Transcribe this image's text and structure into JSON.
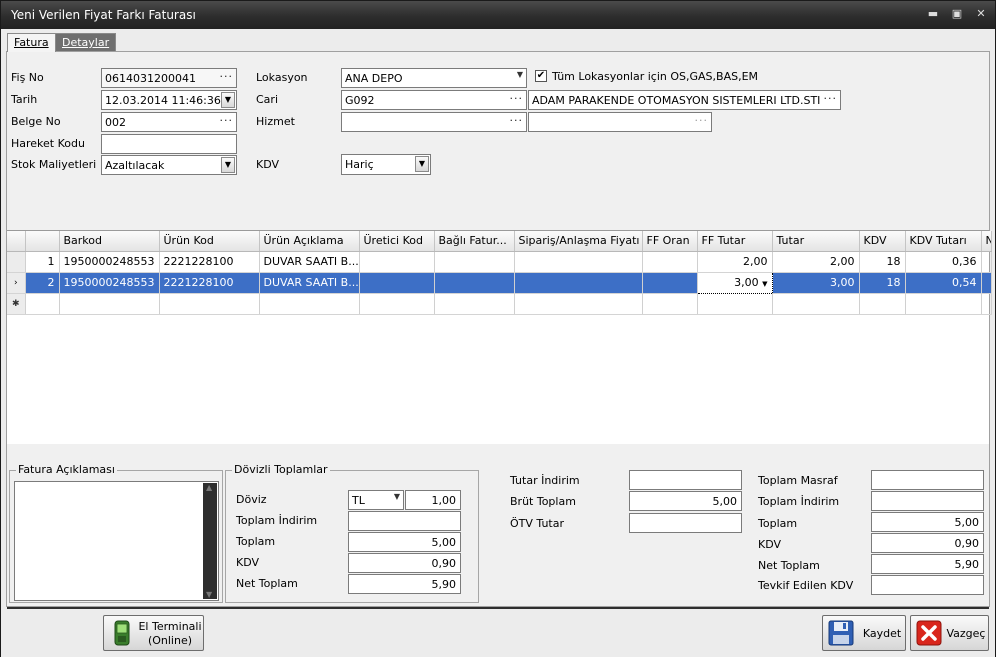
{
  "window": {
    "title": "Yeni Verilen Fiyat Farkı Faturası",
    "minimize_glyph": "▬",
    "maximize_glyph": "▣",
    "close_glyph": "✕"
  },
  "tabs": [
    {
      "label": "Fatura",
      "active": true
    },
    {
      "label": "Detaylar",
      "active": false
    }
  ],
  "form": {
    "fis_no_label": "Fiş No",
    "fis_no_value": "0614031200041",
    "tarih_label": "Tarih",
    "tarih_value": "12.03.2014 11:46:36",
    "belge_no_label": "Belge No",
    "belge_no_value": "002",
    "hareket_kodu_label": "Hareket Kodu",
    "hareket_kodu_value": "",
    "stok_maliyetleri_label": "Stok Maliyetleri",
    "stok_maliyetleri_value": "Azaltılacak",
    "lokasyon_label": "Lokasyon",
    "lokasyon_value": "ANA DEPO",
    "tum_lokasyonlar_label": "Tüm Lokasyonlar için OS,GAS,BAS,EM",
    "tum_lokasyonlar_checked": true,
    "cari_label": "Cari",
    "cari_code": "G092",
    "cari_name": "ADAM PARAKENDE OTOMASYON SISTEMLERI LTD.STI",
    "hizmet_label": "Hizmet",
    "hizmet_code": "",
    "hizmet_name": "",
    "kdv_label": "KDV",
    "kdv_value": "Hariç"
  },
  "grid": {
    "columns": [
      "",
      "",
      "Barkod",
      "Ürün Kod",
      "Ürün Açıklama",
      "Üretici Kod",
      "Bağlı Fatur...",
      "Sipariş/Anlaşma Fiyatı",
      "FF Oran",
      "FF Tutar",
      "Tutar",
      "KDV",
      "KDV Tutarı",
      "N"
    ],
    "rows": [
      {
        "indicator": "",
        "no": "1",
        "barkod": "1950000248553",
        "urun_kod": "2221228100",
        "urun_aciklama": "DUVAR SAATI B...",
        "uretici_kod": "",
        "bagli_fatura": "",
        "siparis_fiyati": "",
        "ff_oran": "",
        "ff_tutar": "2,00",
        "tutar": "2,00",
        "kdv": "18",
        "kdv_tutari": "0,36"
      },
      {
        "indicator": "›",
        "no": "2",
        "barkod": "1950000248553",
        "urun_kod": "2221228100",
        "urun_aciklama": "DUVAR SAATI B...",
        "uretici_kod": "",
        "bagli_fatura": "",
        "siparis_fiyati": "",
        "ff_oran": "",
        "ff_tutar": "3,00",
        "tutar": "3,00",
        "kdv": "18",
        "kdv_tutari": "0,54"
      }
    ],
    "new_row_indicator": "✱"
  },
  "aciklama": {
    "title": "Fatura Açıklaması"
  },
  "dovizli": {
    "title": "Dövizli Toplamlar",
    "doviz_label": "Döviz",
    "doviz_value": "TL",
    "kur_value": "1,00",
    "toplam_indirim_label": "Toplam İndirim",
    "toplam_indirim_value": "",
    "toplam_label": "Toplam",
    "toplam_value": "5,00",
    "kdv_label": "KDV",
    "kdv_value": "0,90",
    "net_toplam_label": "Net Toplam",
    "net_toplam_value": "5,90"
  },
  "totals_mid": {
    "tutar_indirim_label": "Tutar İndirim",
    "tutar_indirim_value": "",
    "brut_toplam_label": "Brüt Toplam",
    "brut_toplam_value": "5,00",
    "otv_tutar_label": "ÖTV Tutar",
    "otv_tutar_value": ""
  },
  "totals_right": {
    "toplam_masraf_label": "Toplam Masraf",
    "toplam_masraf_value": "",
    "toplam_indirim_label": "Toplam İndirim",
    "toplam_indirim_value": "",
    "toplam_label": "Toplam",
    "toplam_value": "5,00",
    "kdv_label": "KDV",
    "kdv_value": "0,90",
    "net_toplam_label": "Net Toplam",
    "net_toplam_value": "5,90",
    "tevkif_label": "Tevkif Edilen KDV",
    "tevkif_value": ""
  },
  "buttons": {
    "el_terminali_line1": "El Terminali",
    "el_terminali_line2": "(Online)",
    "kaydet": "Kaydet",
    "vazgec": "Vazgeç"
  },
  "icons": {
    "terminal": "handheld-terminal-icon",
    "save": "floppy-disk-icon",
    "cancel": "red-x-icon"
  },
  "colors": {
    "title_bar": "#2d2d2d",
    "selection": "#3d6fc6",
    "cancel_red": "#d9261c"
  }
}
